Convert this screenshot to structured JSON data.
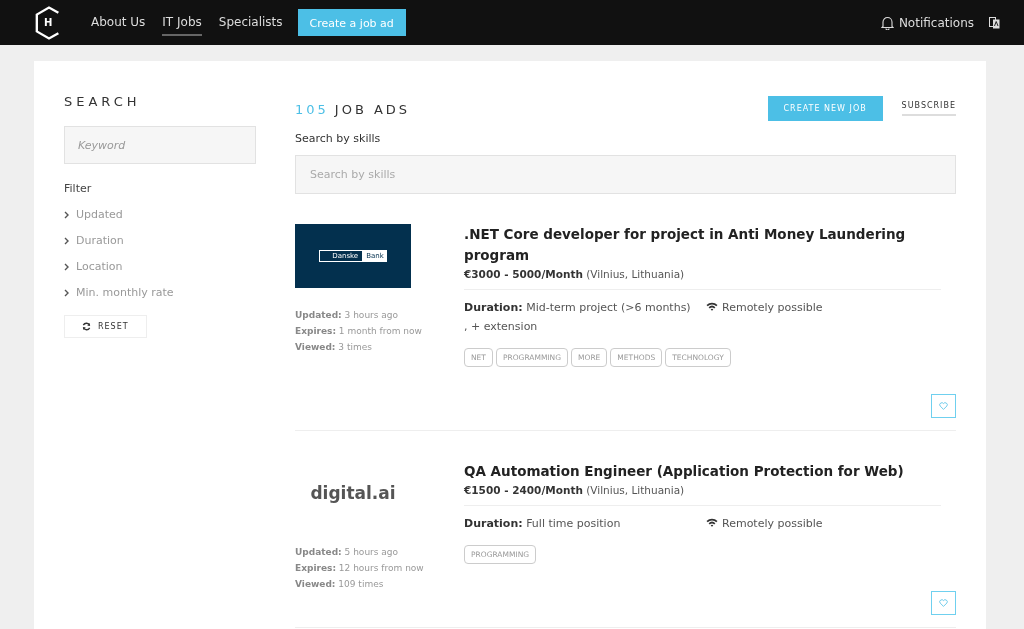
{
  "header": {
    "logo": "H",
    "nav": [
      {
        "label": "About Us",
        "selected": false
      },
      {
        "label": "IT Jobs",
        "selected": true
      },
      {
        "label": "Specialists",
        "selected": false
      }
    ],
    "create_button": "Create a job ad",
    "notifications": "Notifications"
  },
  "sidebar": {
    "title": "SEARCH",
    "keyword_placeholder": "Keyword",
    "filter_label": "Filter",
    "filters": [
      {
        "label": "Updated",
        "expanded": false
      },
      {
        "label": "Duration",
        "expanded": false
      },
      {
        "label": "Location",
        "expanded": false
      },
      {
        "label": "Min. monthly rate",
        "expanded": false
      }
    ],
    "reset": "RESET"
  },
  "main": {
    "count": "105",
    "title": "JOB ADS",
    "new_job": "CREATE NEW JOB",
    "subscribe": "SUBSCRIBE",
    "skills_label": "Search by skills",
    "skills_placeholder": "Search by skills"
  },
  "jobs": [
    {
      "kind": "danske",
      "logo_texts": [
        "Danske",
        "Bank"
      ],
      "title": ".NET Core developer for project in Anti Money Laundering program",
      "salary": "€3000 - 5000/Month",
      "location": "(Vilnius, Lithuania)",
      "duration_label": "Duration:",
      "duration": "Mid-term project (>6 months) , + extension",
      "remote": "Remotely possible",
      "tags": [
        "NET",
        "PROGRAMMING",
        "MORE",
        "METHODS",
        "TECHNOLOGY"
      ],
      "meta": [
        {
          "label": "Updated:",
          "value": "3 hours ago"
        },
        {
          "label": "Expires:",
          "value": "1 month from now"
        },
        {
          "label": "Viewed:",
          "value": "3 times"
        }
      ],
      "favorite": false
    },
    {
      "kind": "digital",
      "logo_texts": [
        "digital.ai"
      ],
      "title": "QA Automation Engineer (Application Protection for Web)",
      "salary": "€1500 - 2400/Month",
      "location": "(Vilnius, Lithuania)",
      "duration_label": "Duration:",
      "duration": "Full time position",
      "remote": "Remotely possible",
      "tags": [
        "PROGRAMMING"
      ],
      "meta": [
        {
          "label": "Updated:",
          "value": "5 hours ago"
        },
        {
          "label": "Expires:",
          "value": "12 hours from now"
        },
        {
          "label": "Viewed:",
          "value": "109 times"
        }
      ],
      "favorite": false
    }
  ]
}
